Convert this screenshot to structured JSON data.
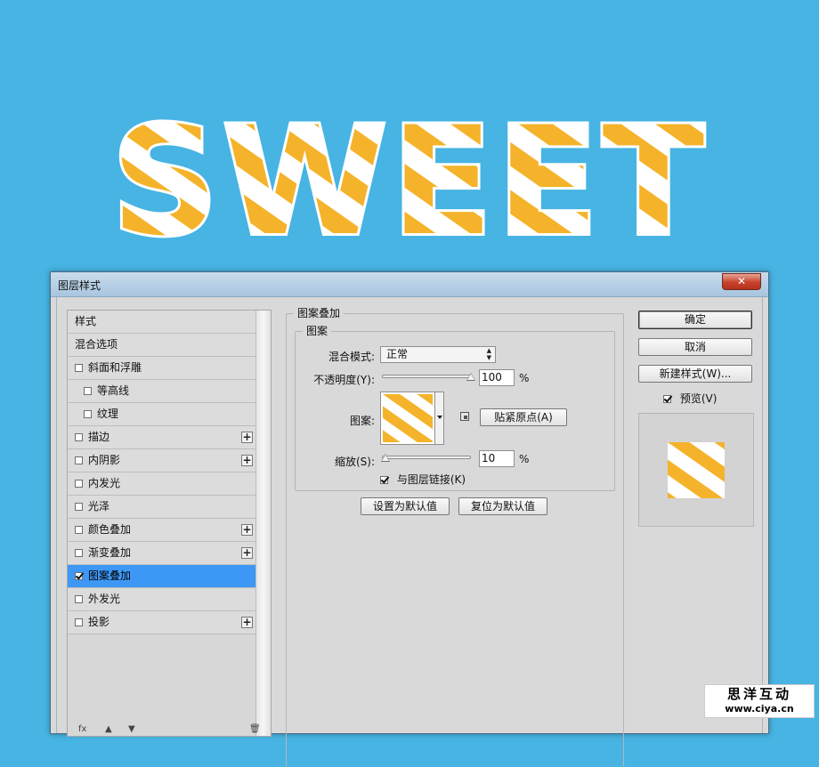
{
  "artwork": {
    "word": "SWEET",
    "stripe_colors": [
      "#f4b32a",
      "#ffffff"
    ],
    "background": "#47b4e3"
  },
  "dialog": {
    "title": "图层样式",
    "close_icon": "close-x-icon"
  },
  "style_list": {
    "items": [
      {
        "label": "样式",
        "checkbox": false,
        "checked": false,
        "plus": false,
        "indent": false,
        "selected": false
      },
      {
        "label": "混合选项",
        "checkbox": false,
        "checked": false,
        "plus": false,
        "indent": false,
        "selected": false
      },
      {
        "label": "斜面和浮雕",
        "checkbox": true,
        "checked": false,
        "plus": false,
        "indent": false,
        "selected": false
      },
      {
        "label": "等高线",
        "checkbox": true,
        "checked": false,
        "plus": false,
        "indent": true,
        "selected": false
      },
      {
        "label": "纹理",
        "checkbox": true,
        "checked": false,
        "plus": false,
        "indent": true,
        "selected": false
      },
      {
        "label": "描边",
        "checkbox": true,
        "checked": false,
        "plus": true,
        "indent": false,
        "selected": false
      },
      {
        "label": "内阴影",
        "checkbox": true,
        "checked": false,
        "plus": true,
        "indent": false,
        "selected": false
      },
      {
        "label": "内发光",
        "checkbox": true,
        "checked": false,
        "plus": false,
        "indent": false,
        "selected": false
      },
      {
        "label": "光泽",
        "checkbox": true,
        "checked": false,
        "plus": false,
        "indent": false,
        "selected": false
      },
      {
        "label": "颜色叠加",
        "checkbox": true,
        "checked": false,
        "plus": true,
        "indent": false,
        "selected": false
      },
      {
        "label": "渐变叠加",
        "checkbox": true,
        "checked": false,
        "plus": true,
        "indent": false,
        "selected": false
      },
      {
        "label": "图案叠加",
        "checkbox": true,
        "checked": true,
        "plus": false,
        "indent": false,
        "selected": true
      },
      {
        "label": "外发光",
        "checkbox": true,
        "checked": false,
        "plus": false,
        "indent": false,
        "selected": false
      },
      {
        "label": "投影",
        "checkbox": true,
        "checked": false,
        "plus": true,
        "indent": false,
        "selected": false
      }
    ],
    "selected_color": "#3d98f5",
    "footer_icons": [
      "fx-icon",
      "arrow-up-icon",
      "arrow-down-icon",
      "trash-icon"
    ]
  },
  "pattern_overlay": {
    "group_title": "图案叠加",
    "subgroup_title": "图案",
    "blend_mode_label": "混合模式:",
    "blend_mode_value": "正常",
    "opacity_label": "不透明度(Y):",
    "opacity_value": "100",
    "opacity_percent": 100,
    "percent_sign": "%",
    "pattern_label": "图案:",
    "snap_origin_button": "贴紧原点(A)",
    "scale_label": "缩放(S):",
    "scale_value": "10",
    "scale_percent": 10,
    "link_label": "与图层链接(K)",
    "link_checked": true,
    "set_default_button": "设置为默认值",
    "reset_default_button": "复位为默认值"
  },
  "actions": {
    "ok": "确定",
    "cancel": "取消",
    "new_style": "新建样式(W)...",
    "preview_label": "预览(V)",
    "preview_checked": true
  },
  "watermark": {
    "line1": "思洋互动",
    "line2": "www.ciya.cn"
  }
}
